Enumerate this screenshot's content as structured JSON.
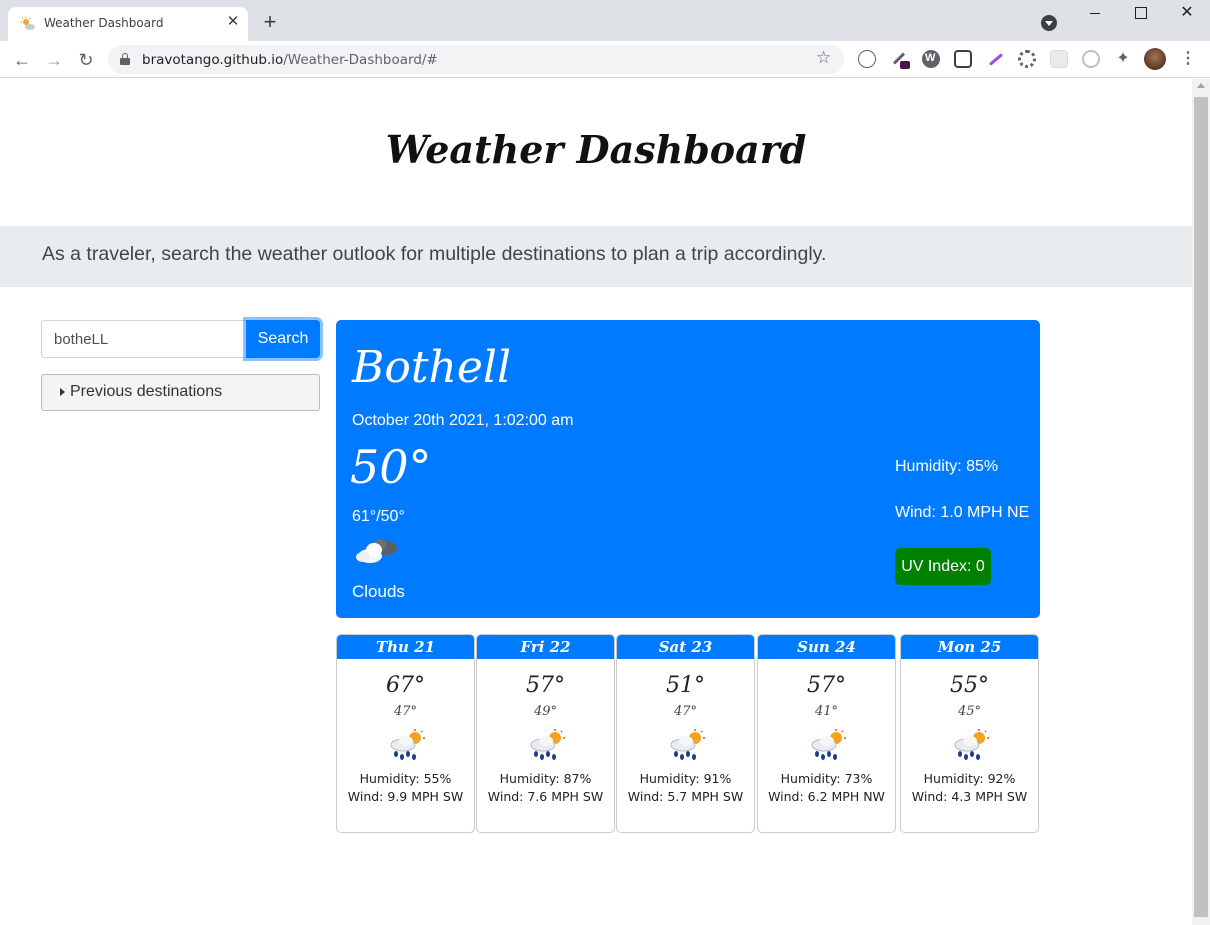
{
  "browser": {
    "tab_title": "Weather Dashboard",
    "url_host": "bravotango.github.io",
    "url_path": "/Weather-Dashboard/#"
  },
  "page": {
    "title": "Weather Dashboard",
    "lead": "As a traveler, search the weather outlook for multiple destinations to plan a trip accordingly."
  },
  "search": {
    "value": "botheLL",
    "button_label": "Search",
    "previous_label": "Previous destinations"
  },
  "current": {
    "city": "Bothell",
    "datetime": "October 20th 2021, 1:02:00 am",
    "temp": "50°",
    "hilo": "61°/50°",
    "icon": "cloud-icon",
    "description": "Clouds",
    "humidity": "Humidity: 85%",
    "wind": "Wind: 1.0 MPH NE",
    "uv": "UV Index: 0",
    "uv_color": "#008000",
    "card_color": "#007bff"
  },
  "forecast": [
    {
      "day": "Thu 21",
      "hi": "67°",
      "lo": "47°",
      "icon": "rain-sun-icon",
      "humidity": "Humidity: 55%",
      "wind": "Wind: 9.9 MPH SW"
    },
    {
      "day": "Fri 22",
      "hi": "57°",
      "lo": "49°",
      "icon": "rain-sun-icon",
      "humidity": "Humidity: 87%",
      "wind": "Wind: 7.6 MPH SW"
    },
    {
      "day": "Sat 23",
      "hi": "51°",
      "lo": "47°",
      "icon": "rain-sun-icon",
      "humidity": "Humidity: 91%",
      "wind": "Wind: 5.7 MPH SW"
    },
    {
      "day": "Sun 24",
      "hi": "57°",
      "lo": "41°",
      "icon": "rain-sun-icon",
      "humidity": "Humidity: 73%",
      "wind": "Wind: 6.2 MPH NW"
    },
    {
      "day": "Mon 25",
      "hi": "55°",
      "lo": "45°",
      "icon": "rain-sun-icon",
      "humidity": "Humidity: 92%",
      "wind": "Wind: 4.3 MPH SW"
    }
  ]
}
